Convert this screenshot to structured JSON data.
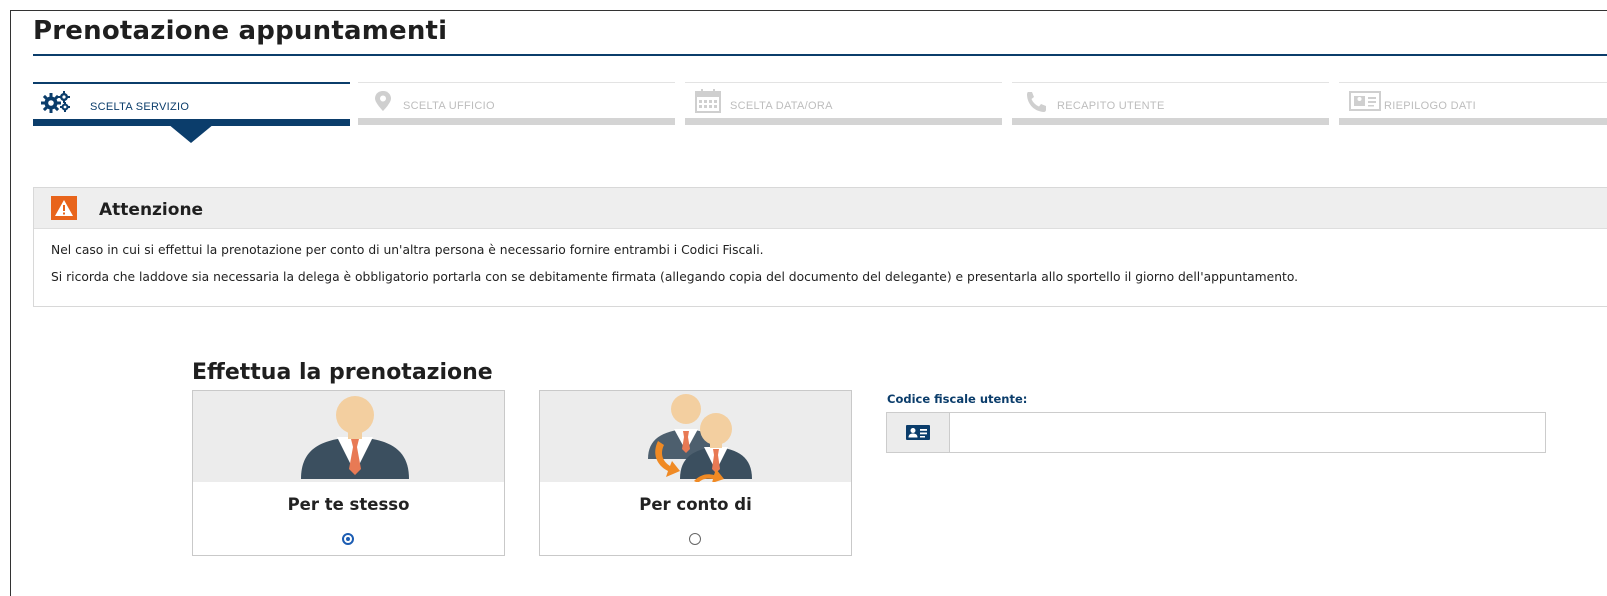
{
  "page": {
    "title": "Prenotazione appuntamenti"
  },
  "steps": [
    {
      "label": "SCELTA SERVIZIO",
      "icon": "gears-icon",
      "active": true
    },
    {
      "label": "SCELTA UFFICIO",
      "icon": "map-pin-icon",
      "active": false
    },
    {
      "label": "SCELTA DATA/ORA",
      "icon": "calendar-icon",
      "active": false
    },
    {
      "label": "RECAPITO UTENTE",
      "icon": "phone-icon",
      "active": false
    },
    {
      "label": "RIEPILOGO DATI",
      "icon": "id-card-icon",
      "active": false
    }
  ],
  "alert": {
    "title": "Attenzione",
    "icon": "warning-icon",
    "line1": "Nel caso in cui si effettui la prenotazione per conto di un'altra persona è necessario fornire entrambi i Codici Fiscali.",
    "line2": "Si ricorda che laddove sia necessaria la delega è obbligatorio portarla con se debitamente firmata (allegando copia del documento del delegante) e presentarla allo sportello il giorno dell'appuntamento."
  },
  "booking": {
    "title": "Effettua la prenotazione",
    "options": [
      {
        "label": "Per te stesso",
        "selected": true
      },
      {
        "label": "Per conto di",
        "selected": false
      }
    ]
  },
  "fiscal_code": {
    "label": "Codice fiscale utente:",
    "value": "",
    "placeholder": ""
  },
  "colors": {
    "primary": "#0b3d6b",
    "alert": "#e8641b",
    "inactive": "#d4d4d4",
    "radio": "#1c5db3"
  }
}
